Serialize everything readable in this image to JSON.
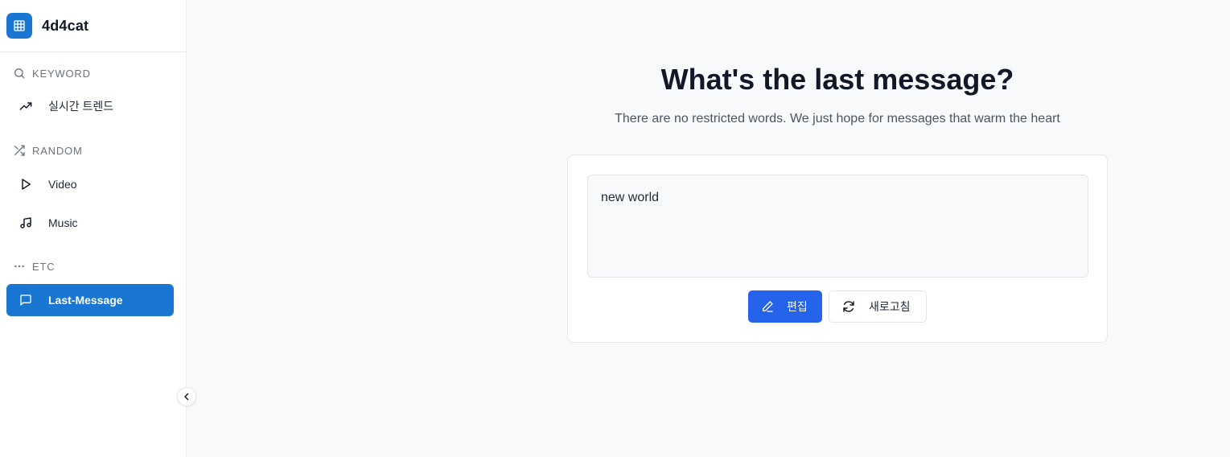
{
  "brand": {
    "name": "4d4cat",
    "icon": "grid-icon",
    "color": "#1976d2"
  },
  "sidebar": {
    "sections": [
      {
        "label": "KEYWORD",
        "icon": "search-icon",
        "items": [
          {
            "label": "실시간 트렌드",
            "icon": "trending-up-icon"
          }
        ]
      },
      {
        "label": "RANDOM",
        "icon": "shuffle-icon",
        "items": [
          {
            "label": "Video",
            "icon": "play-icon"
          },
          {
            "label": "Music",
            "icon": "music-note-icon"
          }
        ]
      },
      {
        "label": "ETC",
        "icon": "more-horizontal-icon",
        "items": [
          {
            "label": "Last-Message",
            "icon": "message-square-icon",
            "active": true
          }
        ]
      }
    ],
    "collapse_icon": "chevron-left-icon"
  },
  "main": {
    "title": "What's the last message?",
    "subtitle": "There are no restricted words. We just hope for messages that warm the heart",
    "message": "new world",
    "edit_button": {
      "label": "편집",
      "icon": "pencil-icon",
      "color": "#2563eb"
    },
    "refresh_button": {
      "label": "새로고침",
      "icon": "refresh-icon"
    }
  }
}
